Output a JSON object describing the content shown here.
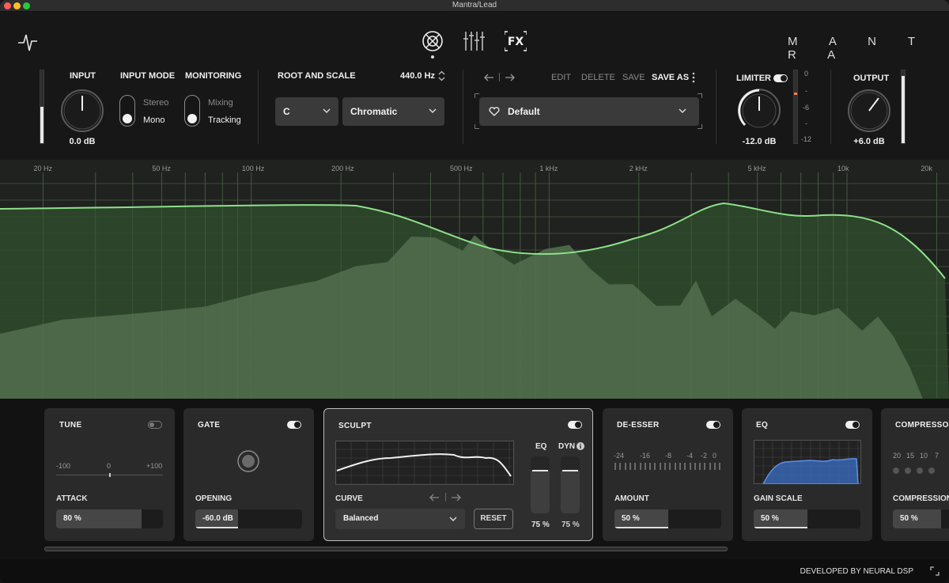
{
  "window": {
    "title": "Mantra/Lead"
  },
  "brand": "M A N T R A",
  "input": {
    "label": "INPUT",
    "value": "0.0 dB",
    "meter_level": 0.5
  },
  "input_mode": {
    "label": "INPUT MODE",
    "option_a": "Stereo",
    "option_b": "Mono",
    "selected": "Mono"
  },
  "monitoring": {
    "label": "MONITORING",
    "option_a": "Mixing",
    "option_b": "Tracking",
    "selected": "Tracking"
  },
  "root_scale": {
    "label": "ROOT AND SCALE",
    "tuning": "440.0 Hz",
    "root": "C",
    "scale": "Chromatic"
  },
  "preset": {
    "edit": "EDIT",
    "delete": "DELETE",
    "save": "SAVE",
    "save_as": "SAVE AS",
    "name": "Default"
  },
  "limiter": {
    "label": "LIMITER",
    "value": "-12.0 dB",
    "enabled": true,
    "scale": [
      "0",
      "-",
      "-6",
      "-",
      "-12"
    ]
  },
  "output": {
    "label": "OUTPUT",
    "value": "+6.0 dB",
    "meter_level": 0.92
  },
  "analyzer": {
    "freq_labels": [
      "20 Hz",
      "50 Hz",
      "100 Hz",
      "200 Hz",
      "500 Hz",
      "1 kHz",
      "2 kHz",
      "5 kHz",
      "10k",
      "20k"
    ],
    "curve_color": "#8ee08a",
    "fill_color": "#4f6a4b"
  },
  "modules": {
    "tune": {
      "title": "TUNE",
      "scale_min": "-100",
      "scale_mid": "0",
      "scale_max": "+100",
      "param": "ATTACK",
      "value": "80 %",
      "level": 0.8,
      "enabled": false
    },
    "gate": {
      "title": "GATE",
      "param": "OPENING",
      "value": "-60.0 dB",
      "level": 0.4,
      "enabled": true
    },
    "sculpt": {
      "title": "SCULPT",
      "eq_label": "EQ",
      "dyn_label": "DYN",
      "curve_label": "CURVE",
      "curve": "Balanced",
      "reset": "RESET",
      "eq_value": "75 %",
      "dyn_value": "75 %",
      "enabled": true
    },
    "deesser": {
      "title": "DE-ESSER",
      "scale": [
        "-24",
        "-16",
        "-8",
        "-4",
        "-2",
        "0"
      ],
      "param": "AMOUNT",
      "value": "50 %",
      "level": 0.5,
      "enabled": true
    },
    "eq": {
      "title": "EQ",
      "param": "GAIN SCALE",
      "value": "50 %",
      "level": 0.5,
      "enabled": true
    },
    "compressor": {
      "title": "COMPRESSOR",
      "scale": [
        "20",
        "15",
        "10",
        "7"
      ],
      "param": "COMPRESSION",
      "value": "50 %"
    }
  },
  "footer": {
    "credit": "DEVELOPED BY NEURAL DSP"
  }
}
